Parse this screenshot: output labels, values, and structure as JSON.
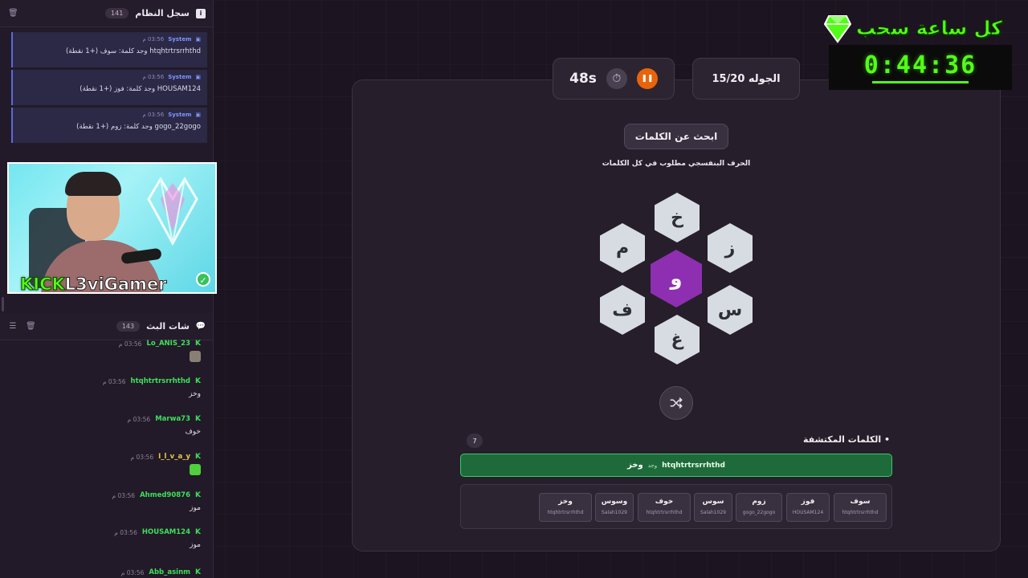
{
  "system_log": {
    "title": "سجل النظام",
    "count": "141",
    "entries": [
      {
        "sender": "System",
        "time": "03:56 م",
        "text": "htqhtrtrsrrhthd وجد كلمة: سوف (+1 نقطة)"
      },
      {
        "sender": "System",
        "time": "03:56 م",
        "text": "HOUSAM124 وجد كلمة: فوز (+1 نقطة)"
      },
      {
        "sender": "System",
        "time": "03:56 م",
        "text": "gogo_22gogo وجد كلمة: زوم (+1 نقطة)"
      }
    ]
  },
  "stream_chat": {
    "title": "شات البث",
    "count": "143",
    "messages": [
      {
        "user": "Lo_ANIS_23",
        "time": "03:56 م",
        "text": "",
        "emote": "cup-emote",
        "user_color": "#3ee05a"
      },
      {
        "user": "htqhtrtrsrrhthd",
        "time": "03:56 م",
        "text": "وخز",
        "emote": "",
        "user_color": "#3ee05a"
      },
      {
        "user": "Marwa73",
        "time": "03:56 م",
        "text": "خوف",
        "emote": "",
        "user_color": "#3ee05a"
      },
      {
        "user": "I_l_v_a_y",
        "time": "03:56 م",
        "text": "",
        "emote": "green-cup-emote",
        "user_color": "#e8c84a"
      },
      {
        "user": "Ahmed90876",
        "time": "03:56 م",
        "text": "موز",
        "emote": "",
        "user_color": "#3ee05a"
      },
      {
        "user": "HOUSAM124",
        "time": "03:56 م",
        "text": "موز",
        "emote": "",
        "user_color": "#3ee05a"
      },
      {
        "user": "Abb_asinm",
        "time": "03:56 م",
        "text": "",
        "emote": "",
        "user_color": "#3ee05a"
      }
    ]
  },
  "webcam": {
    "brand": "KICK",
    "streamer": "L3viGamer"
  },
  "game": {
    "timer": "48s",
    "round": "الجوله 15/20",
    "heading": "ابحث عن الكلمات",
    "subtitle": "الحرف البنفسجي مطلوب في كل الكلمات",
    "center_letter": "و",
    "letters": {
      "top": "خ",
      "top_left": "م",
      "top_right": "ز",
      "bottom_left": "ف",
      "bottom_right": "س",
      "bottom": "غ"
    },
    "found_title": "الكلمات المكتشفة",
    "found_count": "7",
    "last_found": {
      "user": "htqhtrtrsrrhthd",
      "verb": "وجد",
      "word": "وخز"
    },
    "found_words": [
      {
        "word": "سوف",
        "user": "htqhtrtrsrrhthd"
      },
      {
        "word": "فوز",
        "user": "HOUSAM124"
      },
      {
        "word": "زوم",
        "user": "gogo_22gogo"
      },
      {
        "word": "سوس",
        "user": "Salah1029"
      },
      {
        "word": "خوف",
        "user": "htqhtrtrsrrhthd"
      },
      {
        "word": "وسوس",
        "user": "Salah1029"
      },
      {
        "word": "وخز",
        "user": "htqhtrtrsrrhthd"
      }
    ],
    "colors": {
      "center": "#8d2fb0",
      "found_bg": "#1f6a3a",
      "pause": "#e8640c"
    }
  },
  "overlay": {
    "title": "كل ساعة سحب",
    "countdown": "0:44:36",
    "accent": "#53fc18"
  }
}
